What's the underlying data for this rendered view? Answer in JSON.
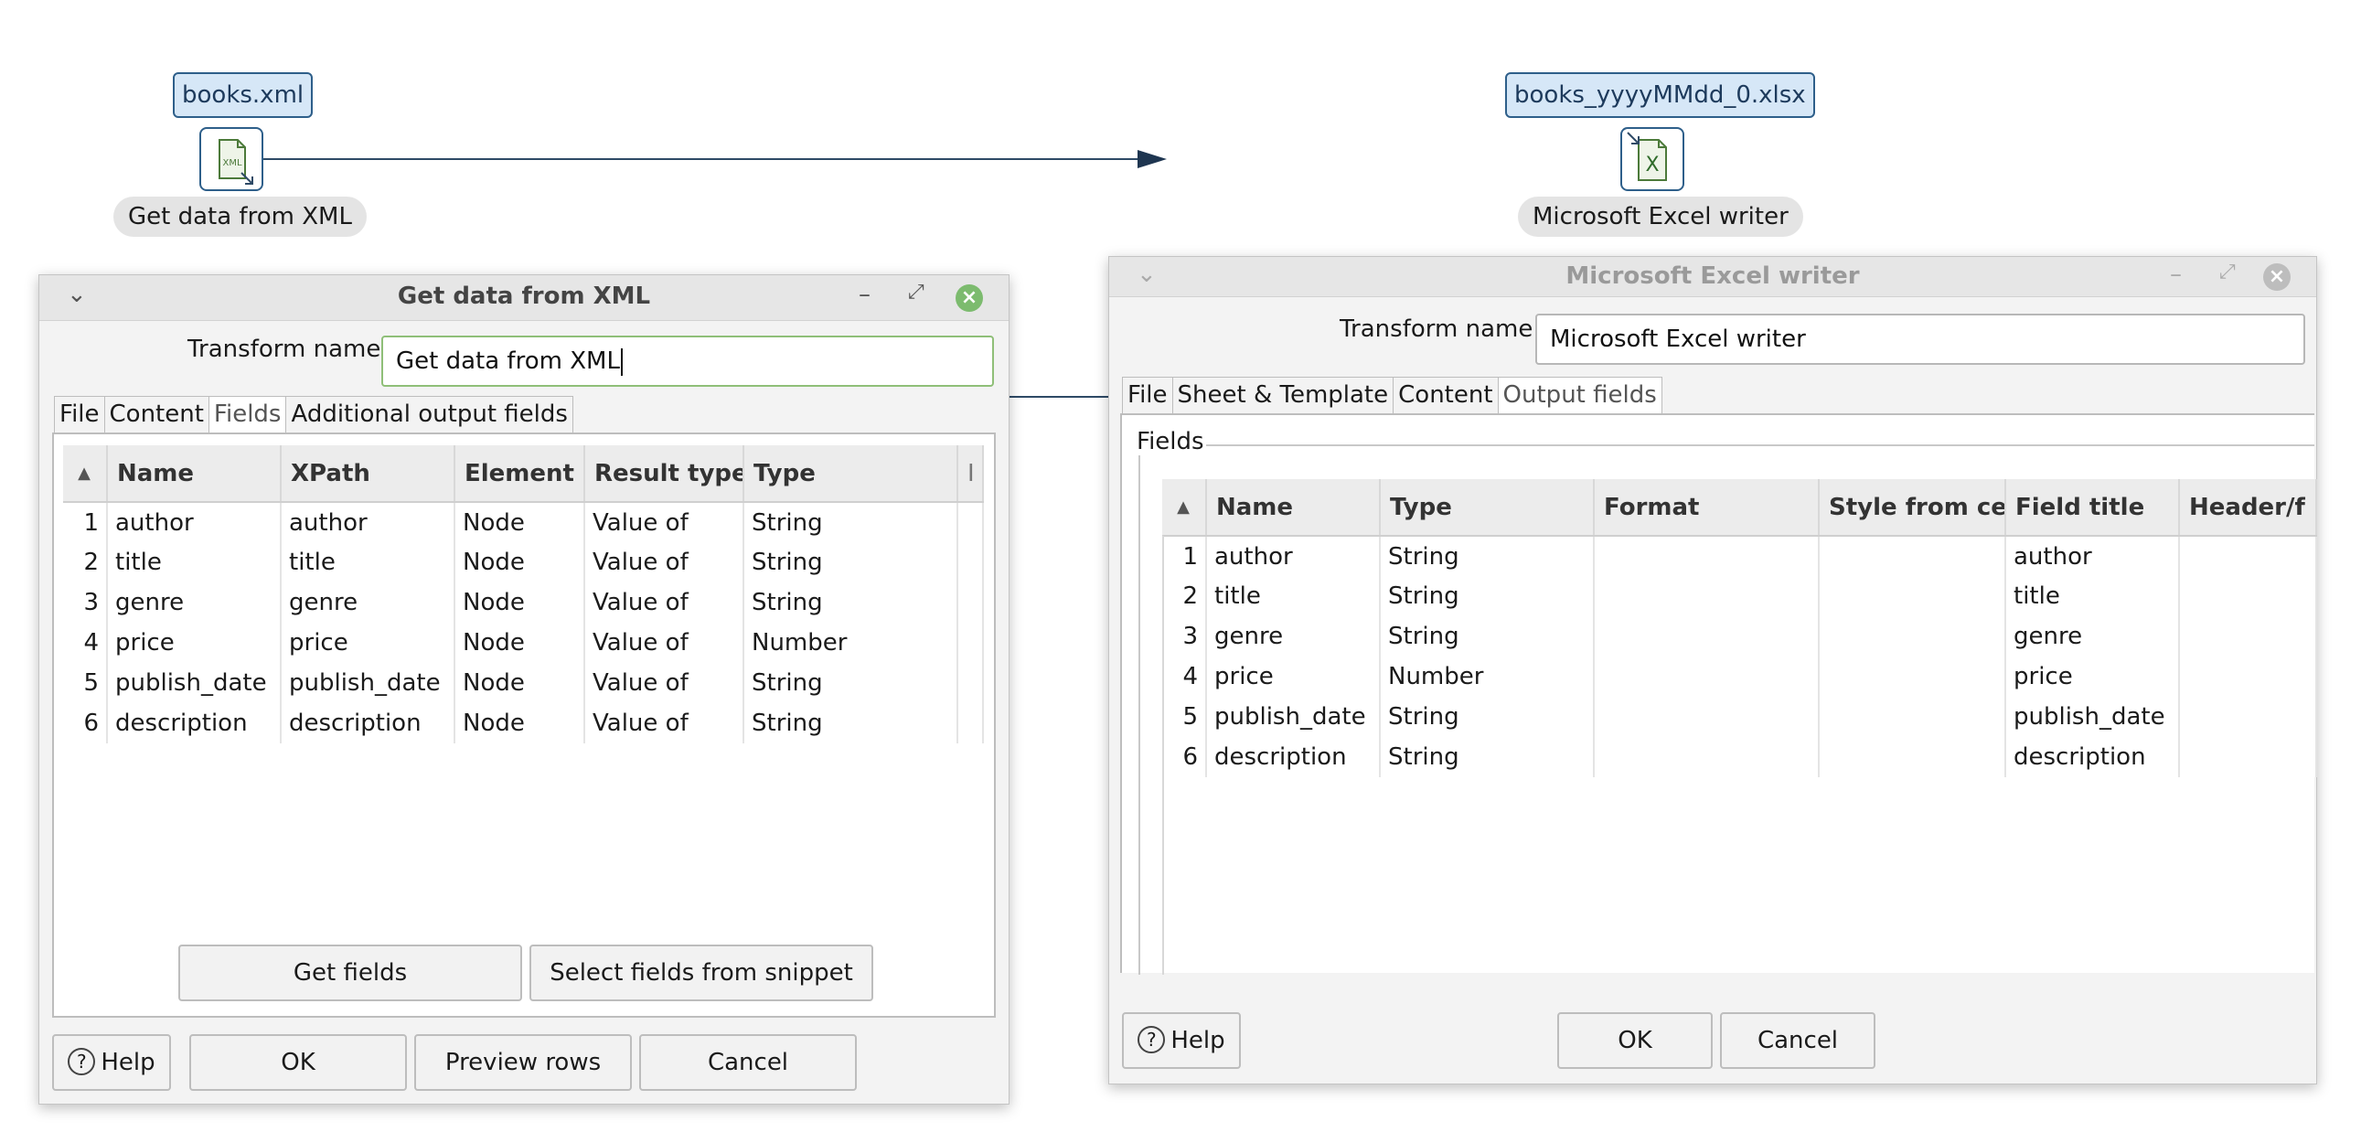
{
  "canvas": {
    "source_node": {
      "file_label": "books.xml",
      "caption": "Get data from XML",
      "icon_text": "XML"
    },
    "target_node": {
      "file_label": "books_yyyyMMdd_0.xlsx",
      "caption": "Microsoft Excel writer",
      "icon_text": "X"
    }
  },
  "xml_dialog": {
    "title": "Get data from XML",
    "transform_name_label": "Transform name",
    "transform_name_value": "Get data from XML",
    "tabs": [
      "File",
      "Content",
      "Fields",
      "Additional output fields"
    ],
    "active_tab": "Fields",
    "columns": [
      "Name",
      "XPath",
      "Element",
      "Result type",
      "Type",
      "I"
    ],
    "rows": [
      {
        "n": "1",
        "name": "author",
        "xpath": "author",
        "element": "Node",
        "result_type": "Value of",
        "type": "String"
      },
      {
        "n": "2",
        "name": "title",
        "xpath": "title",
        "element": "Node",
        "result_type": "Value of",
        "type": "String"
      },
      {
        "n": "3",
        "name": "genre",
        "xpath": "genre",
        "element": "Node",
        "result_type": "Value of",
        "type": "String"
      },
      {
        "n": "4",
        "name": "price",
        "xpath": "price",
        "element": "Node",
        "result_type": "Value of",
        "type": "Number"
      },
      {
        "n": "5",
        "name": "publish_date",
        "xpath": "publish_date",
        "element": "Node",
        "result_type": "Value of",
        "type": "String"
      },
      {
        "n": "6",
        "name": "description",
        "xpath": "description",
        "element": "Node",
        "result_type": "Value of",
        "type": "String"
      }
    ],
    "get_fields_button": "Get fields",
    "snippet_button": "Select fields from snippet",
    "help_button": "Help",
    "ok_button": "OK",
    "preview_button": "Preview rows",
    "cancel_button": "Cancel"
  },
  "excel_dialog": {
    "title": "Microsoft Excel writer",
    "transform_name_label": "Transform name",
    "transform_name_value": "Microsoft Excel writer",
    "tabs": [
      "File",
      "Sheet & Template",
      "Content",
      "Output fields"
    ],
    "active_tab": "Output fields",
    "fields_group_label": "Fields",
    "columns": [
      "Name",
      "Type",
      "Format",
      "Style from cell",
      "Field title",
      "Header/f"
    ],
    "rows": [
      {
        "n": "1",
        "name": "author",
        "type": "String",
        "format": "",
        "style": "",
        "title": "author"
      },
      {
        "n": "2",
        "name": "title",
        "type": "String",
        "format": "",
        "style": "",
        "title": "title"
      },
      {
        "n": "3",
        "name": "genre",
        "type": "String",
        "format": "",
        "style": "",
        "title": "genre"
      },
      {
        "n": "4",
        "name": "price",
        "type": "Number",
        "format": "",
        "style": "",
        "title": "price"
      },
      {
        "n": "5",
        "name": "publish_date",
        "type": "String",
        "format": "",
        "style": "",
        "title": "publish_date"
      },
      {
        "n": "6",
        "name": "description",
        "type": "String",
        "format": "",
        "style": "",
        "title": "description"
      }
    ],
    "help_button": "Help",
    "ok_button": "OK",
    "cancel_button": "Cancel"
  },
  "colors": {
    "hop_line": "#2e4a66",
    "node_border": "#2e5f8a",
    "node_fill": "#d6e7f7",
    "close_active": "#7cbb6e"
  }
}
